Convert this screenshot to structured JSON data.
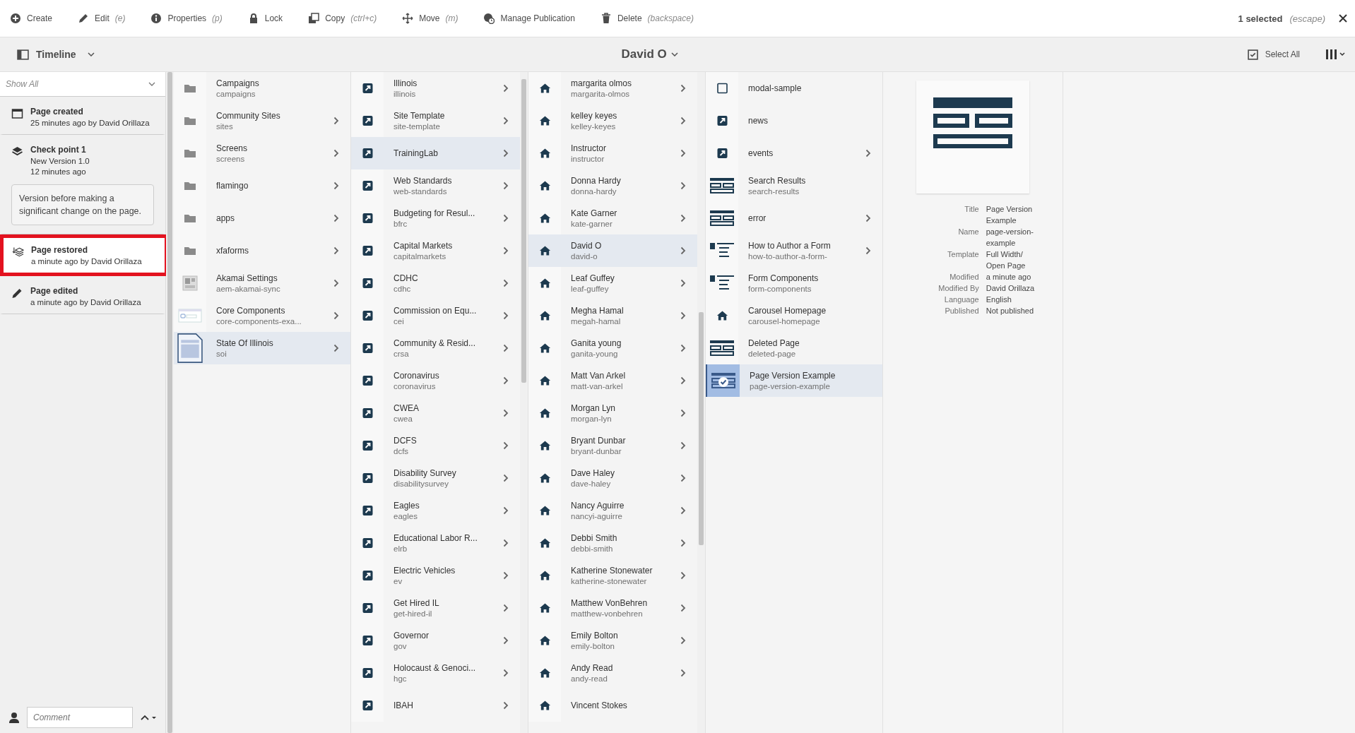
{
  "toolbar": {
    "actions": [
      {
        "kind": "create",
        "label": "Create"
      },
      {
        "kind": "edit",
        "label": "Edit",
        "shortcut": "(e)"
      },
      {
        "kind": "properties",
        "label": "Properties",
        "shortcut": "(p)"
      },
      {
        "kind": "lock",
        "label": "Lock"
      },
      {
        "kind": "copy",
        "label": "Copy",
        "shortcut": "(ctrl+c)"
      },
      {
        "kind": "move",
        "label": "Move",
        "shortcut": "(m)"
      },
      {
        "kind": "publication",
        "label": "Manage Publication"
      },
      {
        "kind": "delete",
        "label": "Delete",
        "shortcut": "(backspace)"
      }
    ],
    "selection": {
      "count": "1 selected",
      "shortcut": "(escape)"
    }
  },
  "header": {
    "rail": "Timeline",
    "title": "David O",
    "select_all": "Select All"
  },
  "timeline": {
    "filter": "Show All",
    "entries": [
      {
        "kind": "created",
        "title": "Page created",
        "lines": [
          "25 minutes ago by David Orillaza"
        ],
        "highlighted": false
      },
      {
        "kind": "version",
        "title": "Check point 1",
        "lines": [
          "New Version 1.0",
          "12 minutes ago"
        ],
        "comment": "Version before making a significant change on the page.",
        "highlighted": false
      },
      {
        "kind": "restored",
        "title": "Page restored",
        "lines": [
          "a minute ago by David Orillaza"
        ],
        "highlighted": true
      },
      {
        "kind": "edited",
        "title": "Page edited",
        "lines": [
          "a minute ago by David Orillaza"
        ],
        "highlighted": false
      }
    ],
    "comment_placeholder": "Comment"
  },
  "columns": [
    {
      "items": [
        {
          "kind": "folder",
          "title": "Campaigns",
          "name": "campaigns",
          "expandable": false,
          "selected": false
        },
        {
          "kind": "folder",
          "title": "Community Sites",
          "name": "sites",
          "expandable": true,
          "selected": false
        },
        {
          "kind": "folder",
          "title": "Screens",
          "name": "screens",
          "expandable": true,
          "selected": false
        },
        {
          "kind": "folder",
          "title": "flamingo",
          "expandable": true,
          "selected": false
        },
        {
          "kind": "folder",
          "title": "apps",
          "expandable": true,
          "selected": false
        },
        {
          "kind": "folder",
          "title": "xfaforms",
          "expandable": true,
          "selected": false
        },
        {
          "kind": "settings",
          "title": "Akamai Settings",
          "name": "aem-akamai-sync",
          "expandable": true,
          "selected": false
        },
        {
          "kind": "component",
          "title": "Core Components",
          "name": "core-components-exa...",
          "expandable": true,
          "selected": false
        },
        {
          "kind": "thumb",
          "title": "State Of Illinois",
          "name": "soi",
          "expandable": true,
          "selected": true
        }
      ]
    },
    {
      "items": [
        {
          "kind": "link",
          "title": "Illinois",
          "name": "illinois",
          "expandable": true,
          "selected": false
        },
        {
          "kind": "link",
          "title": "Site Template",
          "name": "site-template",
          "expandable": true,
          "selected": false
        },
        {
          "kind": "link",
          "title": "TrainingLab",
          "expandable": true,
          "selected": true
        },
        {
          "kind": "link",
          "title": "Web Standards",
          "name": "web-standards",
          "expandable": true,
          "selected": false
        },
        {
          "kind": "link",
          "title": "Budgeting for Resul...",
          "name": "bfrc",
          "expandable": true,
          "selected": false
        },
        {
          "kind": "link",
          "title": "Capital Markets",
          "name": "capitalmarkets",
          "expandable": true,
          "selected": false
        },
        {
          "kind": "link",
          "title": "CDHC",
          "name": "cdhc",
          "expandable": true,
          "selected": false
        },
        {
          "kind": "link",
          "title": "Commission on Equ...",
          "name": "cei",
          "expandable": true,
          "selected": false
        },
        {
          "kind": "link",
          "title": "Community & Resid...",
          "name": "crsa",
          "expandable": true,
          "selected": false
        },
        {
          "kind": "link",
          "title": "Coronavirus",
          "name": "coronavirus",
          "expandable": true,
          "selected": false
        },
        {
          "kind": "link",
          "title": "CWEA",
          "name": "cwea",
          "expandable": true,
          "selected": false
        },
        {
          "kind": "link",
          "title": "DCFS",
          "name": "dcfs",
          "expandable": true,
          "selected": false
        },
        {
          "kind": "link",
          "title": "Disability Survey",
          "name": "disabilitysurvey",
          "expandable": true,
          "selected": false
        },
        {
          "kind": "link",
          "title": "Eagles",
          "name": "eagles",
          "expandable": true,
          "selected": false
        },
        {
          "kind": "link",
          "title": "Educational Labor R...",
          "name": "elrb",
          "expandable": true,
          "selected": false
        },
        {
          "kind": "link",
          "title": "Electric Vehicles",
          "name": "ev",
          "expandable": true,
          "selected": false
        },
        {
          "kind": "link",
          "title": "Get Hired IL",
          "name": "get-hired-il",
          "expandable": true,
          "selected": false
        },
        {
          "kind": "link",
          "title": "Governor",
          "name": "gov",
          "expandable": true,
          "selected": false
        },
        {
          "kind": "link",
          "title": "Holocaust & Genoci...",
          "name": "hgc",
          "expandable": true,
          "selected": false
        },
        {
          "kind": "link",
          "title": "IBAH",
          "expandable": true,
          "selected": false
        }
      ]
    },
    {
      "items": [
        {
          "kind": "home",
          "title": "margarita olmos",
          "name": "margarita-olmos",
          "expandable": true,
          "selected": false
        },
        {
          "kind": "home",
          "title": "kelley keyes",
          "name": "kelley-keyes",
          "expandable": true,
          "selected": false
        },
        {
          "kind": "home",
          "title": "Instructor",
          "name": "instructor",
          "expandable": true,
          "selected": false
        },
        {
          "kind": "home",
          "title": "Donna Hardy",
          "name": "donna-hardy",
          "expandable": true,
          "selected": false
        },
        {
          "kind": "home",
          "title": "Kate Garner",
          "name": "kate-garner",
          "expandable": true,
          "selected": false
        },
        {
          "kind": "home",
          "title": "David O",
          "name": "david-o",
          "expandable": true,
          "selected": true
        },
        {
          "kind": "home",
          "title": "Leaf Guffey",
          "name": "leaf-guffey",
          "expandable": true,
          "selected": false
        },
        {
          "kind": "home",
          "title": "Megha Hamal",
          "name": "megah-hamal",
          "expandable": true,
          "selected": false
        },
        {
          "kind": "home",
          "title": "Ganita young",
          "name": "ganita-young",
          "expandable": true,
          "selected": false
        },
        {
          "kind": "home",
          "title": "Matt Van Arkel",
          "name": "matt-van-arkel",
          "expandable": true,
          "selected": false
        },
        {
          "kind": "home",
          "title": "Morgan Lyn",
          "name": "morgan-lyn",
          "expandable": true,
          "selected": false
        },
        {
          "kind": "home",
          "title": "Bryant Dunbar",
          "name": "bryant-dunbar",
          "expandable": true,
          "selected": false
        },
        {
          "kind": "home",
          "title": "Dave Haley",
          "name": "dave-haley",
          "expandable": true,
          "selected": false
        },
        {
          "kind": "home",
          "title": "Nancy Aguirre",
          "name": "nancyi-aguirre",
          "expandable": true,
          "selected": false
        },
        {
          "kind": "home",
          "title": "Debbi Smith",
          "name": "debbi-smith",
          "expandable": true,
          "selected": false
        },
        {
          "kind": "home",
          "title": "Katherine Stonewater",
          "name": "katherine-stonewater",
          "expandable": true,
          "selected": false
        },
        {
          "kind": "home",
          "title": "Matthew VonBehren",
          "name": "matthew-vonbehren",
          "expandable": true,
          "selected": false
        },
        {
          "kind": "home",
          "title": "Emily Bolton",
          "name": "emily-bolton",
          "expandable": true,
          "selected": false
        },
        {
          "kind": "home",
          "title": "Andy Read",
          "name": "andy-read",
          "expandable": true,
          "selected": false
        },
        {
          "kind": "home",
          "title": "Vincent Stokes",
          "expandable": false,
          "selected": false
        }
      ]
    },
    {
      "items": [
        {
          "kind": "blank",
          "title": "modal-sample",
          "expandable": false,
          "selected": false
        },
        {
          "kind": "link",
          "title": "news",
          "expandable": false,
          "selected": false
        },
        {
          "kind": "link",
          "title": "events",
          "expandable": true,
          "selected": false
        },
        {
          "kind": "layout",
          "title": "Search Results",
          "name": "search-results",
          "expandable": false,
          "selected": false
        },
        {
          "kind": "layout",
          "title": "error",
          "expandable": true,
          "selected": false
        },
        {
          "kind": "form",
          "title": "How to Author a Form",
          "name": "how-to-author-a-form-",
          "expandable": true,
          "selected": false
        },
        {
          "kind": "form",
          "title": "Form Components",
          "name": "form-components",
          "expandable": false,
          "selected": false
        },
        {
          "kind": "home",
          "title": "Carousel Homepage",
          "name": "carousel-homepage",
          "expandable": false,
          "selected": false
        },
        {
          "kind": "layout",
          "title": "Deleted Page",
          "name": "deleted-page",
          "expandable": false,
          "selected": false
        },
        {
          "kind": "layout",
          "title": "Page Version Example",
          "name": "page-version-example",
          "expandable": false,
          "selected": true
        }
      ]
    }
  ],
  "details": {
    "properties": [
      {
        "label": "Title",
        "value": "Page Version Example"
      },
      {
        "label": "Name",
        "value": "page-version-example"
      },
      {
        "label": "Template",
        "value": "Full Width/ Open Page"
      },
      {
        "label": "Modified",
        "value": "a minute ago"
      },
      {
        "label": "Modified By",
        "value": "David Orillaza"
      },
      {
        "label": "Language",
        "value": "English"
      },
      {
        "label": "Published",
        "value": "Not published"
      }
    ]
  }
}
